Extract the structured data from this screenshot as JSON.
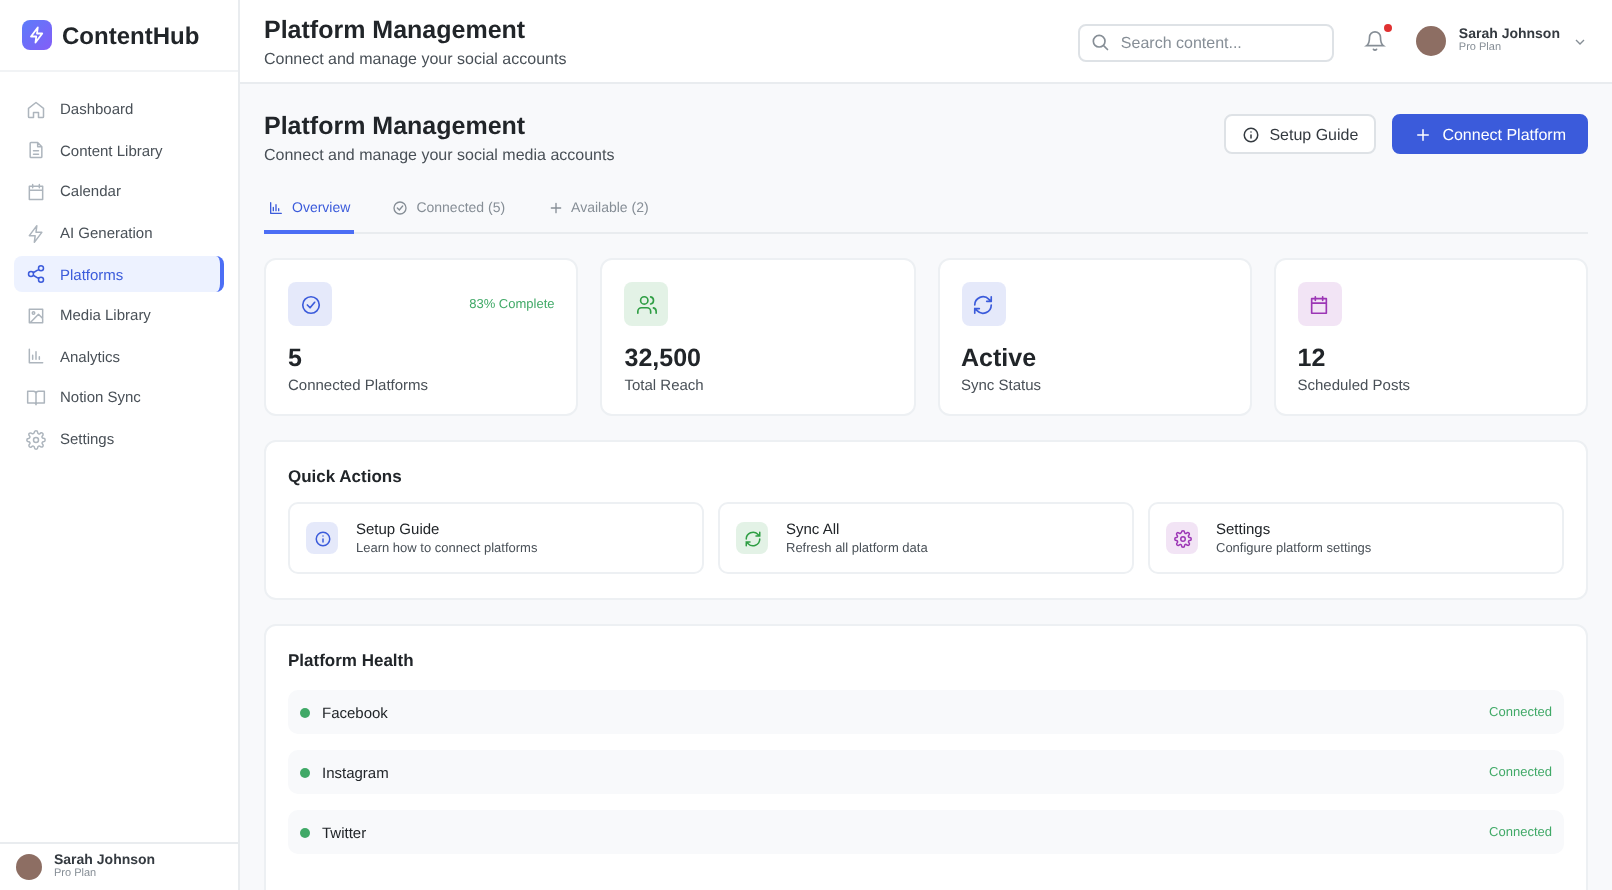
{
  "brand": {
    "name": "ContentHub"
  },
  "sidebar": {
    "items": [
      {
        "label": "Dashboard",
        "selected": false
      },
      {
        "label": "Content Library",
        "selected": false
      },
      {
        "label": "Calendar",
        "selected": false
      },
      {
        "label": "AI Generation",
        "selected": false
      },
      {
        "label": "Platforms",
        "selected": true
      },
      {
        "label": "Media Library",
        "selected": false
      },
      {
        "label": "Analytics",
        "selected": false
      },
      {
        "label": "Notion Sync",
        "selected": false
      },
      {
        "label": "Settings",
        "selected": false
      }
    ],
    "user": {
      "name": "Sarah Johnson",
      "plan": "Pro Plan"
    }
  },
  "header": {
    "title": "Platform Management",
    "subtitle": "Connect and manage your social accounts",
    "search": {
      "placeholder": "Search content..."
    },
    "notification": true,
    "user": {
      "name": "Sarah Johnson",
      "plan": "Pro Plan"
    }
  },
  "page": {
    "title": "Platform Management",
    "subtitle": "Connect and manage your social media accounts",
    "buttons": [
      {
        "label": "Setup Guide",
        "kind": "secondary"
      },
      {
        "label": "Connect Platform",
        "kind": "primary"
      }
    ]
  },
  "tabs": [
    {
      "label": "Overview",
      "selected": true
    },
    {
      "label": "Connected (5)",
      "selected": false
    },
    {
      "label": "Available (2)",
      "selected": false
    }
  ],
  "stats": [
    {
      "value": "5",
      "label": "Connected Platforms",
      "color": "#3b5bdb",
      "badge": "83% Complete"
    },
    {
      "value": "32,500",
      "label": "Total Reach",
      "color": "#2f9e44"
    },
    {
      "value": "Active",
      "label": "Sync Status",
      "color": "#3b5bdb"
    },
    {
      "value": "12",
      "label": "Scheduled Posts",
      "color": "#9c36b5"
    }
  ],
  "quick_actions": {
    "title": "Quick Actions",
    "items": [
      {
        "title": "Setup Guide",
        "description": "Learn how to connect platforms",
        "color": "#3b5bdb"
      },
      {
        "title": "Sync All",
        "description": "Refresh all platform data",
        "color": "#2f9e44"
      },
      {
        "title": "Settings",
        "description": "Configure platform settings",
        "color": "#9c36b5"
      }
    ]
  },
  "platform_health": {
    "title": "Platform Health",
    "rows": [
      {
        "name": "Facebook",
        "status": "Connected",
        "color": "#40a967"
      },
      {
        "name": "Instagram",
        "status": "Connected",
        "color": "#40a967"
      },
      {
        "name": "Twitter",
        "status": "Connected",
        "color": "#40a967"
      }
    ]
  }
}
